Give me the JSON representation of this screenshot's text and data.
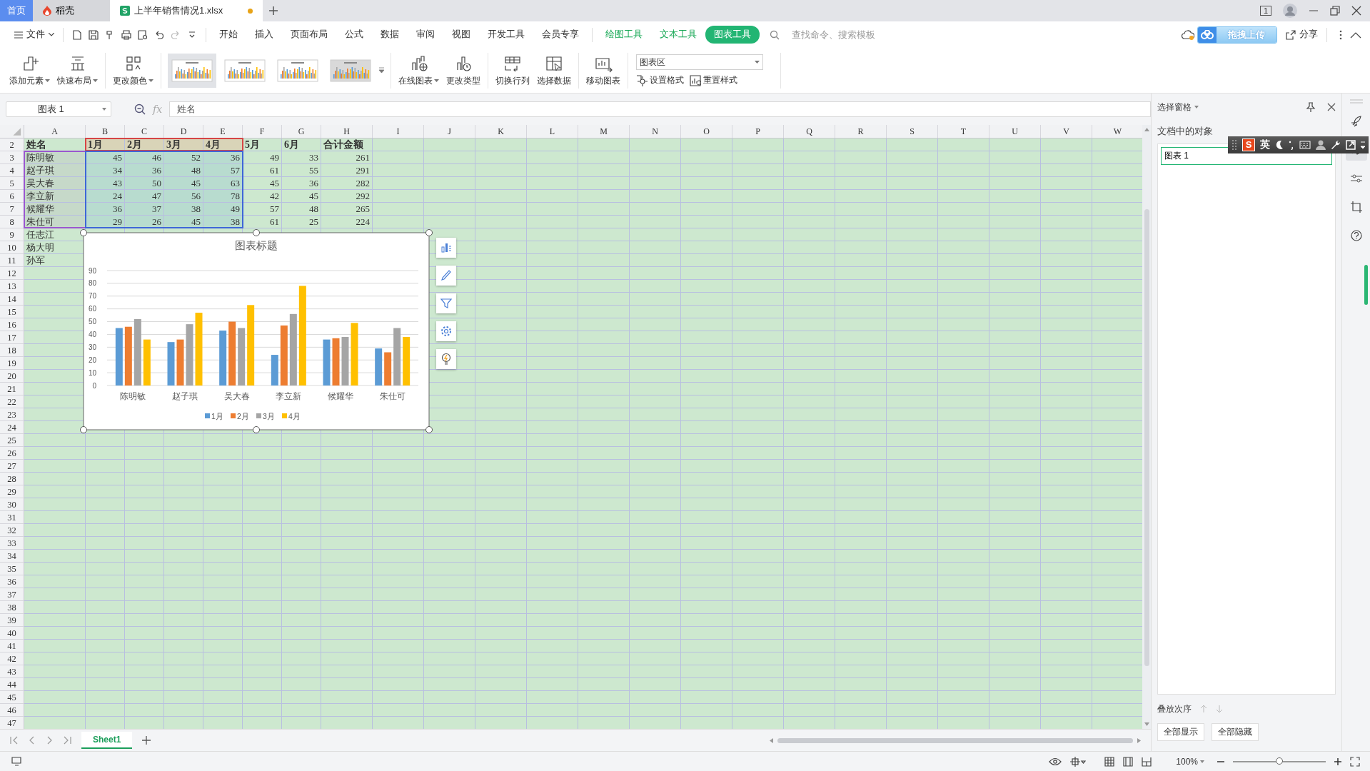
{
  "tabs": [
    {
      "kind": "home",
      "label": "首页",
      "selected": false
    },
    {
      "kind": "app",
      "label": "稻壳",
      "selected": false
    },
    {
      "kind": "doc",
      "label": "上半年销售情况1.xlsx",
      "selected": true,
      "modified": true
    }
  ],
  "title_bar": {
    "window_count": "1"
  },
  "menu": {
    "file": "文件",
    "tabs": [
      {
        "label": "开始",
        "kind": "main",
        "selected": false
      },
      {
        "label": "插入",
        "kind": "main",
        "selected": false
      },
      {
        "label": "页面布局",
        "kind": "main",
        "selected": false
      },
      {
        "label": "公式",
        "kind": "main",
        "selected": false
      },
      {
        "label": "数据",
        "kind": "main",
        "selected": false
      },
      {
        "label": "审阅",
        "kind": "main",
        "selected": false
      },
      {
        "label": "视图",
        "kind": "main",
        "selected": false
      },
      {
        "label": "开发工具",
        "kind": "main",
        "selected": false
      },
      {
        "label": "会员专享",
        "kind": "main",
        "selected": false
      },
      {
        "label": "绘图工具",
        "kind": "context",
        "selected": false
      },
      {
        "label": "文本工具",
        "kind": "context",
        "selected": false
      },
      {
        "label": "图表工具",
        "kind": "context",
        "selected": true
      }
    ],
    "search": {
      "placeholder": "查找命令、搜索模板"
    },
    "upload_popup": "拖拽上传",
    "share": "分享"
  },
  "ribbon": {
    "buttons_left": [
      {
        "kind": "add-element",
        "label": "添加元素",
        "dropdown": true
      },
      {
        "kind": "quick-layout",
        "label": "快速布局",
        "dropdown": true
      },
      {
        "kind": "change-color",
        "label": "更改颜色",
        "dropdown": true
      }
    ],
    "chart_styles": [
      {
        "selected": true
      },
      {
        "selected": false
      },
      {
        "selected": false
      },
      {
        "selected": false
      }
    ],
    "buttons_right": [
      {
        "kind": "online-chart",
        "label": "在线图表",
        "dropdown": true
      },
      {
        "kind": "change-type",
        "label": "更改类型",
        "dropdown": false
      },
      {
        "kind": "switch",
        "label": "切换行列",
        "dropdown": false
      },
      {
        "kind": "select-data",
        "label": "选择数据",
        "dropdown": false
      },
      {
        "kind": "move-chart",
        "label": "移动图表",
        "dropdown": false
      }
    ],
    "chart_element": {
      "value": "图表区"
    },
    "small_buttons": [
      {
        "kind": "format",
        "label": "设置格式"
      },
      {
        "kind": "reset",
        "label": "重置样式"
      }
    ]
  },
  "formula": {
    "name_box": "图表 1",
    "fx_label": "fx",
    "value": "姓名"
  },
  "sheet": {
    "columns": [
      "A",
      "B",
      "C",
      "D",
      "E",
      "F",
      "G",
      "H",
      "I",
      "J",
      "K",
      "L",
      "M",
      "N",
      "O",
      "P",
      "Q",
      "R",
      "S",
      "T",
      "U",
      "V",
      "W"
    ],
    "rows": [
      {
        "number": "2",
        "kind": "header",
        "cells": [
          "姓名",
          {
            "text": "1月",
            "kind": "series"
          },
          {
            "text": "2月",
            "kind": "series"
          },
          {
            "text": "3月",
            "kind": "series"
          },
          {
            "text": "4月",
            "kind": "series"
          },
          "5月",
          "6月",
          "合计金额"
        ]
      },
      {
        "number": "3",
        "kind": "data",
        "cells": [
          {
            "text": "陈明敏",
            "kind": "categories"
          },
          {
            "text": "45",
            "kind": "values"
          },
          {
            "text": "46",
            "kind": "values"
          },
          {
            "text": "52",
            "kind": "values"
          },
          {
            "text": "36",
            "kind": "values"
          },
          "49",
          "33",
          "261"
        ]
      },
      {
        "number": "4",
        "kind": "data",
        "cells": [
          {
            "text": "赵子琪",
            "kind": "categories"
          },
          {
            "text": "34",
            "kind": "values"
          },
          {
            "text": "36",
            "kind": "values"
          },
          {
            "text": "48",
            "kind": "values"
          },
          {
            "text": "57",
            "kind": "values"
          },
          "61",
          "55",
          "291"
        ]
      },
      {
        "number": "5",
        "kind": "data",
        "cells": [
          {
            "text": "吴大春",
            "kind": "categories"
          },
          {
            "text": "43",
            "kind": "values"
          },
          {
            "text": "50",
            "kind": "values"
          },
          {
            "text": "45",
            "kind": "values"
          },
          {
            "text": "63",
            "kind": "values"
          },
          "45",
          "36",
          "282"
        ]
      },
      {
        "number": "6",
        "kind": "data",
        "cells": [
          {
            "text": "李立新",
            "kind": "categories"
          },
          {
            "text": "24",
            "kind": "values"
          },
          {
            "text": "47",
            "kind": "values"
          },
          {
            "text": "56",
            "kind": "values"
          },
          {
            "text": "78",
            "kind": "values"
          },
          "42",
          "45",
          "292"
        ]
      },
      {
        "number": "7",
        "kind": "data",
        "cells": [
          {
            "text": "候耀华",
            "kind": "categories"
          },
          {
            "text": "36",
            "kind": "values"
          },
          {
            "text": "37",
            "kind": "values"
          },
          {
            "text": "38",
            "kind": "values"
          },
          {
            "text": "49",
            "kind": "values"
          },
          "57",
          "48",
          "265"
        ]
      },
      {
        "number": "8",
        "kind": "data",
        "cells": [
          {
            "text": "朱仕可",
            "kind": "categories"
          },
          {
            "text": "29",
            "kind": "values"
          },
          {
            "text": "26",
            "kind": "values"
          },
          {
            "text": "45",
            "kind": "values"
          },
          {
            "text": "38",
            "kind": "values"
          },
          "61",
          "25",
          "224"
        ]
      },
      {
        "number": "9",
        "kind": "data",
        "cells": [
          "任志江"
        ]
      },
      {
        "number": "10",
        "kind": "data",
        "cells": [
          "杨大明"
        ]
      },
      {
        "number": "11",
        "kind": "data",
        "cells": [
          "孙军"
        ]
      },
      {
        "number": "12"
      },
      {
        "number": "13"
      },
      {
        "number": "14"
      },
      {
        "number": "15"
      },
      {
        "number": "16"
      },
      {
        "number": "17"
      },
      {
        "number": "18"
      },
      {
        "number": "19"
      },
      {
        "number": "20"
      },
      {
        "number": "21"
      },
      {
        "number": "22"
      },
      {
        "number": "23"
      },
      {
        "number": "24"
      },
      {
        "number": "25"
      },
      {
        "number": "26"
      },
      {
        "number": "27"
      },
      {
        "number": "28"
      },
      {
        "number": "29"
      },
      {
        "number": "30"
      },
      {
        "number": "31"
      },
      {
        "number": "32"
      },
      {
        "number": "33"
      },
      {
        "number": "34"
      },
      {
        "number": "35"
      },
      {
        "number": "36"
      },
      {
        "number": "37"
      },
      {
        "number": "38"
      },
      {
        "number": "39"
      },
      {
        "number": "40"
      },
      {
        "number": "41"
      },
      {
        "number": "42"
      },
      {
        "number": "43"
      },
      {
        "number": "44"
      },
      {
        "number": "45"
      },
      {
        "number": "46"
      },
      {
        "number": "47"
      }
    ],
    "chart": {
      "chart_data": {
        "type": "bar",
        "title": "图表标题",
        "categories": [
          "陈明敏",
          "赵子琪",
          "吴大春",
          "李立新",
          "候耀华",
          "朱仕可"
        ],
        "series": [
          {
            "name": "1月",
            "color": "#5b9bd5",
            "values": [
              45,
              34,
              43,
              24,
              36,
              29
            ]
          },
          {
            "name": "2月",
            "color": "#ed7d31",
            "values": [
              46,
              36,
              50,
              47,
              37,
              26
            ]
          },
          {
            "name": "3月",
            "color": "#a5a5a5",
            "values": [
              52,
              48,
              45,
              56,
              38,
              45
            ]
          },
          {
            "name": "4月",
            "color": "#ffc000",
            "values": [
              36,
              57,
              63,
              78,
              49,
              38
            ]
          }
        ],
        "ylim": [
          0,
          90
        ],
        "yticks": [
          0,
          10,
          20,
          30,
          40,
          50,
          60,
          70,
          80,
          90
        ],
        "grid": true,
        "legend": true
      }
    },
    "chart_tools": [
      {
        "kind": "elements"
      },
      {
        "kind": "style"
      },
      {
        "kind": "filter"
      },
      {
        "kind": "settings"
      },
      {
        "kind": "idea"
      }
    ]
  },
  "sheet_tabs": [
    {
      "label": "Sheet1",
      "selected": true
    }
  ],
  "pane": {
    "title": "选择窗格",
    "heading": "文档中的对象",
    "objects": [
      {
        "label": "图表 1",
        "selected": true
      }
    ],
    "order_label": "叠放次序",
    "buttons": [
      "全部显示",
      "全部隐藏"
    ]
  },
  "side_icons": [
    {
      "kind": "rocket",
      "selected": false
    },
    {
      "kind": "cursor",
      "selected": true
    },
    {
      "kind": "sliders",
      "selected": false
    },
    {
      "kind": "crop",
      "selected": false
    },
    {
      "kind": "help",
      "selected": false
    }
  ],
  "ime": {
    "logo": "S",
    "mode": "英"
  },
  "status": {
    "zoom": "100%",
    "level": 0.5
  }
}
